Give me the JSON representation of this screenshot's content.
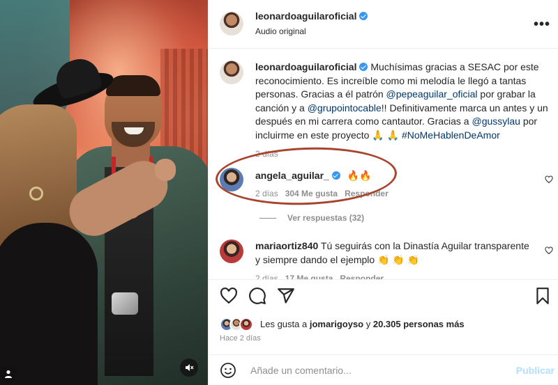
{
  "post": {
    "author": "leonardoaguilaroficial",
    "audio": "Audio original"
  },
  "caption": {
    "author": "leonardoaguilaroficial",
    "text_1": "Muchísimas gracias a SESAC por este reconocimiento. Es increíble como mi melodía le llegó a tantas personas. Gracias a él patrón ",
    "mention_1": "@pepeaguilar_oficial",
    "text_2": " por grabar la canción y a ",
    "mention_2": "@grupointocable",
    "text_3": "!! Definitivamente marca un antes y un después en mi carrera como cantautor. Gracias a ",
    "mention_3": "@gussylau",
    "text_4": " por incluirme en este proyecto 🙏 🙏 ",
    "hashtag": "#NoMeHablenDeAmor",
    "time": "2 días"
  },
  "comments": [
    {
      "user": "angela_aguilar_",
      "text": "🔥🔥",
      "time": "2 días",
      "likes": "304 Me gusta",
      "reply": "Responder",
      "view_replies": "Ver respuestas (32)"
    },
    {
      "user": "mariaortiz840",
      "text": "Tú seguirás con la Dinastía Aguilar transparente y siempre dando el ejemplo 👏 👏 👏",
      "time": "2 días",
      "likes": "17 Me gusta",
      "reply": "Responder"
    }
  ],
  "likes": {
    "prefix": "Les gusta a ",
    "user": "jomarigoyso",
    "middle": " y ",
    "count": "20.305 personas más",
    "time": "Hace 2 días"
  },
  "add_comment": {
    "placeholder": "Añade un comentario...",
    "post": "Publicar"
  },
  "icons": [
    "heart-icon",
    "comment-icon",
    "share-icon",
    "bookmark-icon",
    "emoji-icon",
    "more-icon",
    "verified-icon",
    "mute-icon",
    "user-tag-icon"
  ],
  "colors": {
    "verified": "#3897f0",
    "link": "#00376b",
    "annotation": "#a8442c",
    "publish": "#b2dffc"
  }
}
